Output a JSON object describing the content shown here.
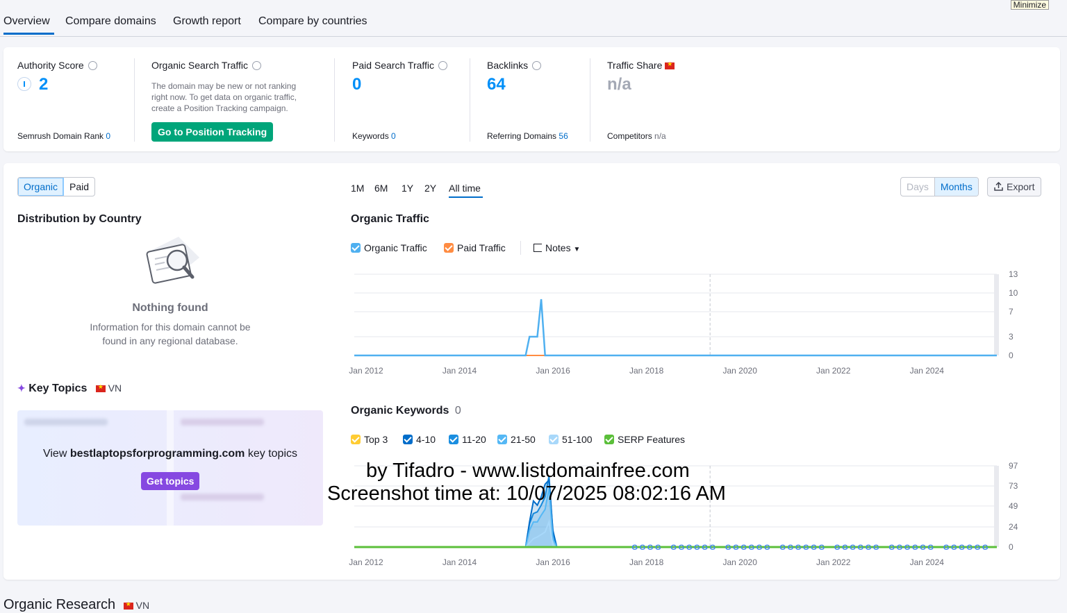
{
  "minimize_label": "Minimize",
  "nav": {
    "tabs": [
      "Overview",
      "Compare domains",
      "Growth report",
      "Compare by countries"
    ]
  },
  "summary": {
    "authority": {
      "label": "Authority Score",
      "value": "2",
      "sub_label": "Semrush Domain Rank",
      "sub_value": "0"
    },
    "organic": {
      "label": "Organic Search Traffic",
      "message_lines": [
        "The domain may be new or not ranking",
        "right now. To get data on organic traffic,",
        "create a Position Tracking campaign."
      ],
      "button": "Go to Position Tracking"
    },
    "paid": {
      "label": "Paid Search Traffic",
      "value": "0",
      "sub_label": "Keywords",
      "sub_value": "0"
    },
    "backlinks": {
      "label": "Backlinks",
      "value": "64",
      "sub_label": "Referring Domains",
      "sub_value": "56"
    },
    "share": {
      "label": "Traffic Share",
      "value": "n/a",
      "sub_label": "Competitors",
      "sub_value": "n/a"
    }
  },
  "toggles": {
    "organic": "Organic",
    "paid": "Paid"
  },
  "periods": [
    "1M",
    "6M",
    "1Y",
    "2Y",
    "All time"
  ],
  "active_period": "All time",
  "granularity": {
    "days": "Days",
    "months": "Months"
  },
  "export_label": "Export",
  "distribution": {
    "title": "Distribution by Country",
    "empty_title": "Nothing found",
    "empty_lines": [
      "Information for this domain cannot be",
      "found in any regional database."
    ]
  },
  "key_topics": {
    "title": "Key Topics",
    "country": "VN",
    "view_prefix": "View ",
    "domain": "bestlaptopsforprogramming.com",
    "view_suffix": " key topics",
    "button": "Get topics"
  },
  "traffic_chart": {
    "title": "Organic Traffic",
    "legend": {
      "organic": "Organic Traffic",
      "paid": "Paid Traffic",
      "notes": "Notes"
    }
  },
  "keywords_chart": {
    "title": "Organic Keywords",
    "count": "0",
    "legend": [
      "Top 3",
      "4-10",
      "11-20",
      "21-50",
      "51-100",
      "SERP Features"
    ]
  },
  "organic_research": {
    "title": "Organic Research",
    "country": "VN"
  },
  "watermark": {
    "line1": "by Tifadro - www.listdomainfree.com",
    "line2": "Screenshot time at: 10/07/2025 08:02:16 AM"
  },
  "colors": {
    "accent": "#006dca",
    "value_blue": "#008ff8",
    "green_button": "#00a57a",
    "purple_button": "#8649e1",
    "organic_line": "#4fb0f0",
    "paid_line": "#ff8c42",
    "top3": "#ffcc33",
    "pos_4_10": "#006dca",
    "pos_11_20": "#1a8ee0",
    "pos_21_50": "#55b8f5",
    "pos_51_100": "#a8d8fa",
    "serp": "#5bbf3a"
  },
  "chart_data": [
    {
      "type": "line",
      "title": "Organic Traffic",
      "x": [
        "2012-01",
        "2014-01",
        "2015-09",
        "2015-10",
        "2015-11",
        "2015-12",
        "2016-01",
        "2016-02",
        "2016-03",
        "2018-01",
        "2020-01",
        "2022-01",
        "2024-01",
        "2025-10"
      ],
      "x_tick_labels": [
        "Jan 2012",
        "Jan 2014",
        "Jan 2016",
        "Jan 2018",
        "Jan 2020",
        "Jan 2022",
        "Jan 2024"
      ],
      "y_tick_labels": [
        "0",
        "3",
        "7",
        "10",
        "13"
      ],
      "ylim": [
        0,
        13
      ],
      "series": [
        {
          "name": "Organic Traffic",
          "values": [
            0,
            0,
            0,
            3,
            3,
            3,
            9,
            0,
            0,
            0,
            0,
            0,
            0,
            0
          ]
        },
        {
          "name": "Paid Traffic",
          "values": [
            0,
            0,
            0,
            0,
            0,
            0,
            0,
            0,
            0,
            0,
            0,
            0,
            0,
            0
          ]
        }
      ]
    },
    {
      "type": "area",
      "title": "Organic Keywords",
      "x": [
        "2012-01",
        "2014-01",
        "2015-09",
        "2015-10",
        "2015-11",
        "2015-12",
        "2016-01",
        "2016-02",
        "2016-03",
        "2016-04",
        "2016-05",
        "2018-01",
        "2020-01",
        "2022-01",
        "2024-01",
        "2025-10"
      ],
      "x_tick_labels": [
        "Jan 2012",
        "Jan 2014",
        "Jan 2016",
        "Jan 2018",
        "Jan 2020",
        "Jan 2022",
        "Jan 2024"
      ],
      "y_tick_labels": [
        "0",
        "24",
        "49",
        "73",
        "97"
      ],
      "ylim": [
        0,
        97
      ],
      "series": [
        {
          "name": "Top 3",
          "values": [
            0,
            0,
            0,
            0,
            0,
            0,
            0,
            0,
            0,
            0,
            0,
            0,
            0,
            0,
            0,
            0
          ]
        },
        {
          "name": "4-10",
          "values": [
            0,
            0,
            0,
            30,
            55,
            50,
            60,
            75,
            80,
            20,
            0,
            0,
            0,
            0,
            0,
            0
          ]
        },
        {
          "name": "11-20",
          "values": [
            0,
            0,
            0,
            28,
            40,
            42,
            50,
            60,
            85,
            18,
            0,
            0,
            0,
            0,
            0,
            0
          ]
        },
        {
          "name": "21-50",
          "values": [
            0,
            0,
            0,
            20,
            30,
            30,
            38,
            45,
            70,
            10,
            0,
            0,
            0,
            0,
            0,
            0
          ]
        },
        {
          "name": "51-100",
          "values": [
            0,
            0,
            0,
            5,
            10,
            12,
            15,
            18,
            30,
            2,
            0,
            0,
            0,
            0,
            0,
            0
          ]
        },
        {
          "name": "SERP Features",
          "values": [
            0,
            0,
            0,
            0,
            0,
            0,
            0,
            0,
            0,
            0,
            0,
            0,
            0,
            0,
            0,
            0
          ]
        }
      ]
    }
  ]
}
